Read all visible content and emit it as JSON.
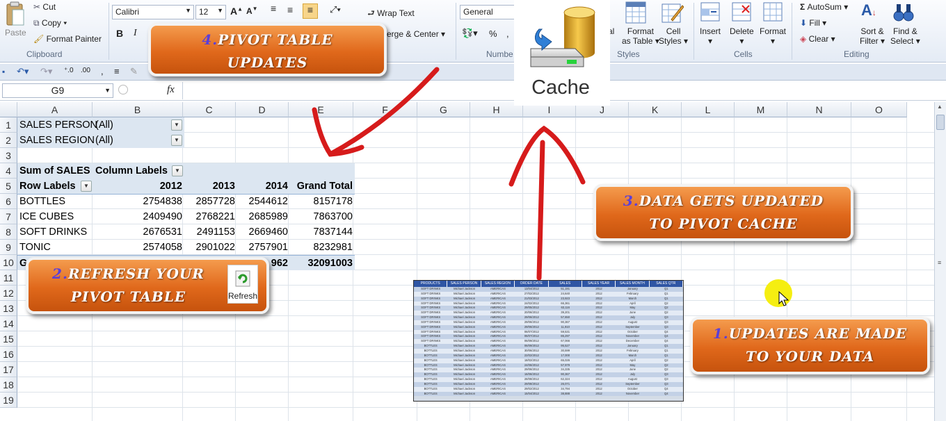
{
  "ribbon": {
    "clipboard": {
      "cut": "Cut",
      "copy": "Copy",
      "paste": "Paste",
      "format_painter": "Format Painter",
      "group": "Clipboard"
    },
    "font": {
      "name": "Calibri",
      "size": "12"
    },
    "alignment": {
      "wrap_text": "Wrap Text",
      "merge_center": "erge & Center"
    },
    "number": {
      "format": "General",
      "group": "Numbe"
    },
    "styles": {
      "cond_fmt_partial": "al",
      "format_as_table": "Format",
      "format_as_table_2": "as Table",
      "cell_styles": "Cell",
      "cell_styles_2": "Styles",
      "group": "Styles"
    },
    "cells": {
      "insert": "Insert",
      "delete": "Delete",
      "format": "Format",
      "group": "Cells"
    },
    "editing": {
      "autosum": "AutoSum",
      "fill": "Fill",
      "clear": "Clear",
      "sort_filter": "Sort &",
      "sort_filter_2": "Filter",
      "find_select": "Find &",
      "find_select_2": "Select",
      "group": "Editing"
    }
  },
  "formula_bar": {
    "name_box": "G9",
    "fx": "fx",
    "value": ""
  },
  "columns": [
    "A",
    "B",
    "C",
    "D",
    "E",
    "F",
    "G",
    "H",
    "I",
    "J",
    "K",
    "L",
    "M",
    "N",
    "O"
  ],
  "rows": [
    "1",
    "2",
    "3",
    "4",
    "5",
    "6",
    "7",
    "8",
    "9",
    "10",
    "11",
    "12",
    "13",
    "14",
    "15",
    "16",
    "17",
    "18",
    "19"
  ],
  "pivot": {
    "filter1_label": "SALES PERSON",
    "filter1_value": "(All)",
    "filter2_label": "SALES REGION",
    "filter2_value": "(All)",
    "values_label": "Sum of SALES",
    "col_labels": "Column Labels",
    "row_labels": "Row Labels",
    "years": [
      "2012",
      "2013",
      "2014"
    ],
    "grand_total": "Grand Total",
    "data": [
      {
        "label": "BOTTLES",
        "v": [
          "2754838",
          "2857728",
          "2544612",
          "8157178"
        ]
      },
      {
        "label": "ICE CUBES",
        "v": [
          "2409490",
          "2768221",
          "2685989",
          "7863700"
        ]
      },
      {
        "label": "SOFT DRINKS",
        "v": [
          "2676531",
          "2491153",
          "2669460",
          "7837144"
        ]
      },
      {
        "label": "TONIC",
        "v": [
          "2574058",
          "2901022",
          "2757901",
          "8232981"
        ]
      }
    ],
    "total_row_partial_label": "G",
    "total_partial_2014": "962",
    "total_grand": "32091003"
  },
  "cache_label": "Cache",
  "refresh_label": "Refresh",
  "callouts": {
    "c1_num": "1.",
    "c1_text": "Updates are made",
    "c1_text2": "to your data",
    "c2_num": "2.",
    "c2_text": "Refresh your",
    "c2_text2": "pivot table",
    "c3_num": "3.",
    "c3_text": "Data gets updated",
    "c3_text2": "to pivot cache",
    "c4_num": "4.",
    "c4_text": "Pivot table",
    "c4_text2": "updates"
  },
  "source_data": {
    "headers": [
      "PRODUCTS",
      "SALES PERSON",
      "SALES REGION",
      "ORDER DATE",
      "SALES",
      "SALES YEAR",
      "SALES MONTH",
      "SALES QTR"
    ],
    "rows": [
      [
        "SOFT DRINKS",
        "Michael Jackson",
        "AMERICAS",
        "13/04/2012",
        "51,191",
        "2012",
        "January",
        "Q1"
      ],
      [
        "SOFT DRINKS",
        "Michael Jackson",
        "AMERICAS",
        "27/02/2012",
        "24,640",
        "2012",
        "February",
        "Q1"
      ],
      [
        "SOFT DRINKS",
        "Michael Jackson",
        "AMERICAS",
        "21/03/2012",
        "23,923",
        "2012",
        "March",
        "Q1"
      ],
      [
        "SOFT DRINKS",
        "Michael Jackson",
        "AMERICAS",
        "24/02/2012",
        "66,361",
        "2012",
        "April",
        "Q2"
      ],
      [
        "SOFT DRINKS",
        "Michael Jackson",
        "AMERICAS",
        "29/05/2012",
        "63,116",
        "2012",
        "May",
        "Q2"
      ],
      [
        "SOFT DRINKS",
        "Michael Jackson",
        "AMERICAS",
        "20/06/2012",
        "39,201",
        "2012",
        "June",
        "Q2"
      ],
      [
        "SOFT DRINKS",
        "Michael Jackson",
        "AMERICAS",
        "29/06/2012",
        "57,650",
        "2012",
        "July",
        "Q3"
      ],
      [
        "SOFT DRINKS",
        "Michael Jackson",
        "AMERICAS",
        "29/06/2012",
        "90,367",
        "2012",
        "August",
        "Q3"
      ],
      [
        "SOFT DRINKS",
        "Michael Jackson",
        "AMERICAS",
        "29/06/2012",
        "11,910",
        "2012",
        "September",
        "Q3"
      ],
      [
        "SOFT DRINKS",
        "Michael Jackson",
        "AMERICAS",
        "06/07/2012",
        "59,531",
        "2012",
        "October",
        "Q4"
      ],
      [
        "SOFT DRINKS",
        "Michael Jackson",
        "AMERICAS",
        "06/07/2012",
        "86,297",
        "2012",
        "November",
        "Q4"
      ],
      [
        "SOFT DRINKS",
        "Michael Jackson",
        "AMERICAS",
        "06/09/2012",
        "67,066",
        "2012",
        "December",
        "Q4"
      ],
      [
        "BOTTLES",
        "Michael Jackson",
        "AMERICAS",
        "06/09/2012",
        "95,527",
        "2012",
        "January",
        "Q1"
      ],
      [
        "BOTTLES",
        "Michael Jackson",
        "AMERICAS",
        "30/06/2012",
        "30,599",
        "2012",
        "February",
        "Q1"
      ],
      [
        "BOTTLES",
        "Michael Jackson",
        "AMERICAS",
        "22/02/2012",
        "17,000",
        "2012",
        "March",
        "Q1"
      ],
      [
        "BOTTLES",
        "Michael Jackson",
        "AMERICAS",
        "18/02/2012",
        "65,026",
        "2012",
        "April",
        "Q2"
      ],
      [
        "BOTTLES",
        "Michael Jackson",
        "AMERICAS",
        "24/06/2012",
        "57,979",
        "2012",
        "May",
        "Q2"
      ],
      [
        "BOTTLES",
        "Michael Jackson",
        "AMERICAS",
        "29/06/2012",
        "34,335",
        "2012",
        "June",
        "Q2"
      ],
      [
        "BOTTLES",
        "Michael Jackson",
        "AMERICAS",
        "16/06/2012",
        "90,367",
        "2012",
        "July",
        "Q3"
      ],
      [
        "BOTTLES",
        "Michael Jackson",
        "AMERICAS",
        "28/08/2012",
        "62,324",
        "2012",
        "August",
        "Q3"
      ],
      [
        "BOTTLES",
        "Michael Jackson",
        "AMERICAS",
        "29/08/2012",
        "26,071",
        "2012",
        "September",
        "Q3"
      ],
      [
        "BOTTLES",
        "Michael Jackson",
        "AMERICAS",
        "29/02/2012",
        "34,794",
        "2012",
        "October",
        "Q4"
      ],
      [
        "BOTTLES",
        "Michael Jackson",
        "AMERICAS",
        "15/04/2012",
        "38,888",
        "2012",
        "November",
        "Q4"
      ]
    ]
  },
  "colors": {
    "callout": "#e0681b",
    "callout_number": "#5b3fd8",
    "arrow": "#d61b1b",
    "pivot_header_bg": "#dce6f1",
    "selection_cursor": "#f5ee11"
  }
}
